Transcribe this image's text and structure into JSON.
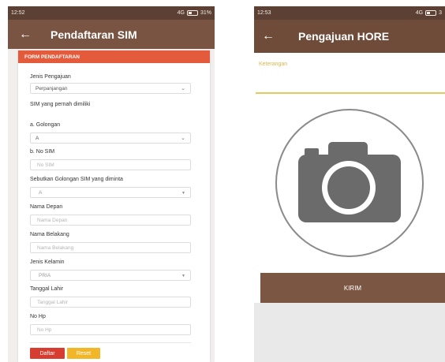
{
  "left_screen": {
    "status": {
      "time": "12:52",
      "network": "4G",
      "battery": "31%"
    },
    "appbar": {
      "back": "←",
      "title": "Pendaftaran SIM"
    },
    "form": {
      "header": "FORM PENDAFTARAN",
      "jenis_pengajuan": {
        "label": "Jenis Pengajuan",
        "value": "Perpanjangan"
      },
      "sim_dimiliki_label": "SIM yang pernah dimiliki",
      "golongan": {
        "label": "a. Golongan",
        "value": "A"
      },
      "no_sim": {
        "label": "b. No SIM",
        "placeholder": "No SIM"
      },
      "golongan_diminta": {
        "label": "Sebutkan Golongan SIM yang diminta",
        "value": "A"
      },
      "nama_depan": {
        "label": "Nama Depan",
        "placeholder": "Nama Depan"
      },
      "nama_belakang": {
        "label": "Nama Belakang",
        "placeholder": "Nama Belakang"
      },
      "jenis_kelamin": {
        "label": "Jenis Kelamin",
        "value": "PRIA"
      },
      "tanggal_lahir": {
        "label": "Tanggal Lahir",
        "placeholder": "Tanggal Lahir"
      },
      "no_hp": {
        "label": "No Hp",
        "placeholder": "No Hp"
      },
      "buttons": {
        "daftar": "Daftar",
        "reset": "Reset"
      }
    }
  },
  "right_screen": {
    "status": {
      "time": "12:53",
      "network": "4G",
      "battery": "3"
    },
    "appbar": {
      "back": "←",
      "title": "Pengajuan HORE"
    },
    "keterangan_label": "Keterangan",
    "submit_label": "KIRIM"
  },
  "colors": {
    "appbar": "#7a5442",
    "statusbar": "#5c4033",
    "form_header": "#e45b3b",
    "daftar_button": "#d63c2f",
    "reset_button": "#f2b728",
    "keterangan_accent": "#e6c85c"
  },
  "icons": {
    "back": "arrow-left-icon",
    "dropdown": "chevron-down-icon",
    "camera": "camera-icon"
  }
}
